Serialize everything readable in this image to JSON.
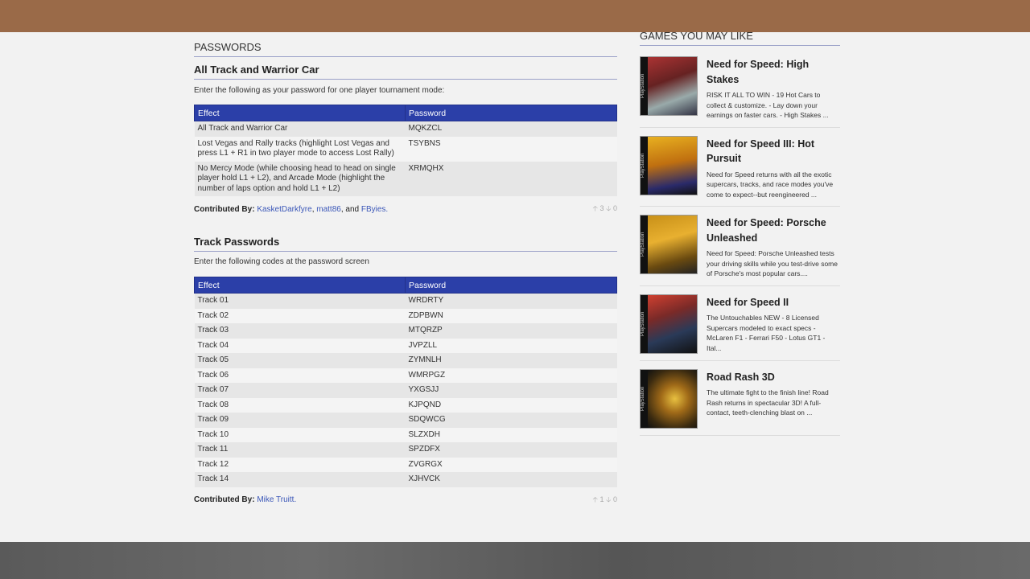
{
  "main": {
    "section_title": "PASSWORDS",
    "block1": {
      "heading": "All Track and Warrior Car",
      "intro": "Enter the following as your password for one player tournament mode:",
      "columns": [
        "Effect",
        "Password"
      ],
      "rows": [
        {
          "effect": "All Track and Warrior Car",
          "password": "MQKZCL"
        },
        {
          "effect": "Lost Vegas and Rally tracks (highlight Lost Vegas and press L1 + R1 in two player mode to access Lost Rally)",
          "password": "TSYBNS"
        },
        {
          "effect": "No Mercy Mode (while choosing head to head on single player hold L1 + L2), and Arcade Mode (highlight the number of laps option and hold L1 + L2)",
          "password": "XRMQHX"
        }
      ],
      "contributed_label": "Contributed By:",
      "contributors": [
        "KasketDarkfyre",
        "matt86",
        "FByies."
      ],
      "and_text": "and",
      "votes_up": "3",
      "votes_down": "0"
    },
    "block2": {
      "heading": "Track Passwords",
      "intro": "Enter the following codes at the password screen",
      "columns": [
        "Effect",
        "Password"
      ],
      "rows": [
        {
          "effect": "Track 01",
          "password": "WRDRTY"
        },
        {
          "effect": "Track 02",
          "password": "ZDPBWN"
        },
        {
          "effect": "Track 03",
          "password": "MTQRZP"
        },
        {
          "effect": "Track 04",
          "password": "JVPZLL"
        },
        {
          "effect": "Track 05",
          "password": "ZYMNLH"
        },
        {
          "effect": "Track 06",
          "password": "WMRPGZ"
        },
        {
          "effect": "Track 07",
          "password": "YXGSJJ"
        },
        {
          "effect": "Track 08",
          "password": "KJPQND"
        },
        {
          "effect": "Track 09",
          "password": "SDQWCG"
        },
        {
          "effect": "Track 10",
          "password": "SLZXDH"
        },
        {
          "effect": "Track 11",
          "password": "SPZDFX"
        },
        {
          "effect": "Track 12",
          "password": "ZVGRGX"
        },
        {
          "effect": "Track 14",
          "password": "XJHVCK"
        }
      ],
      "contributed_label": "Contributed By:",
      "contributors": [
        "Mike Truitt."
      ],
      "votes_up": "1",
      "votes_down": "0"
    }
  },
  "sidebar": {
    "title": "GAMES YOU MAY LIKE",
    "platform_label": "PlayStation",
    "games": [
      {
        "title": "Need for Speed: High Stakes",
        "desc": "RISK IT ALL TO WIN - 19 Hot Cars to collect & customize. - Lay down your earnings on faster cars. - High Stakes ...",
        "art_color": "#8a2a20"
      },
      {
        "title": "Need for Speed III: Hot Pursuit",
        "desc": "Need for Speed returns with all the exotic supercars, tracks, and race modes you've come to expect--but reengineered ...",
        "art_color": "#c88a18"
      },
      {
        "title": "Need for Speed: Porsche Unleashed",
        "desc": "Need for Speed: Porsche Unleashed tests your driving skills while you test-drive some of Porsche's most popular cars....",
        "art_color": "#d8a020"
      },
      {
        "title": "Need for Speed II",
        "desc": "The Untouchables NEW - 8 Licensed Supercars modeled to exact specs - McLaren F1 - Ferrari F50 - Lotus GT1 - Ital...",
        "art_color": "#3a4a58"
      },
      {
        "title": "Road Rash 3D",
        "desc": "The ultimate fight to the finish line! Road Rash returns in spectacular 3D! A full-contact, teeth-clenching blast on ...",
        "art_color": "#5a4a2a"
      }
    ]
  },
  "colors": {
    "topbar": "#9a6a48",
    "table_header": "#2b3fa8",
    "link": "#3b57b8"
  }
}
